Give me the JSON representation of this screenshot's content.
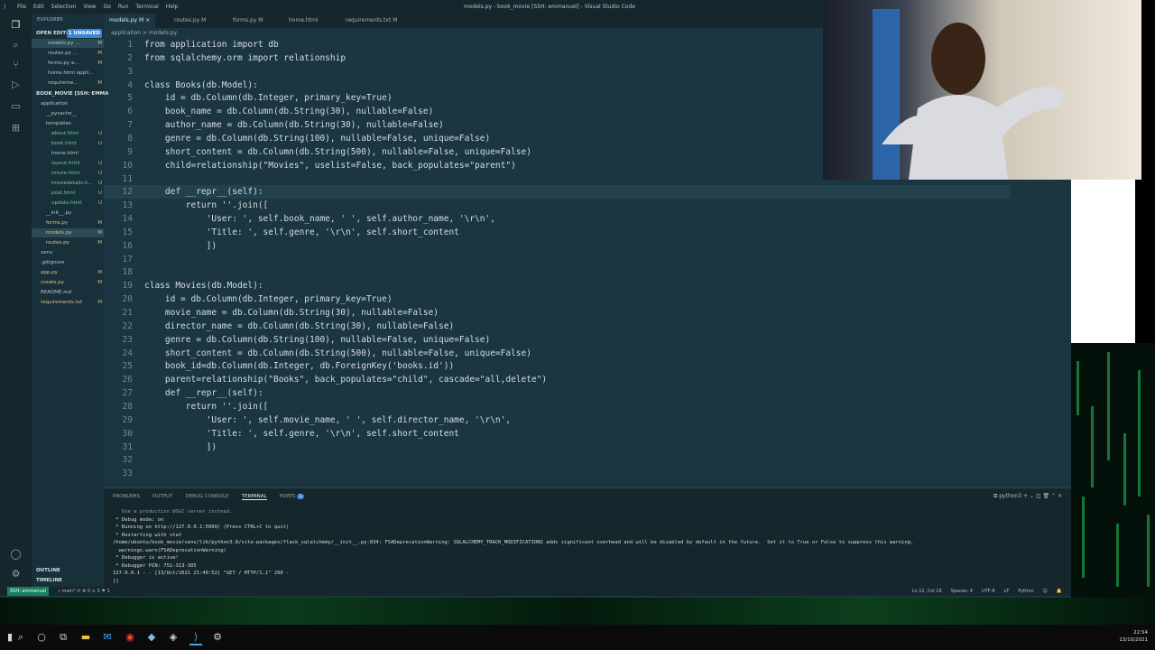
{
  "app": {
    "window_title": "models.py - book_movie [SSH: emmanuel] - Visual Studio Code",
    "menu": [
      "File",
      "Edit",
      "Selection",
      "View",
      "Go",
      "Run",
      "Terminal",
      "Help"
    ]
  },
  "tabs": [
    {
      "label": "models.py M",
      "active": true
    },
    {
      "label": "routes.py M",
      "active": false
    },
    {
      "label": "forms.py M",
      "active": false
    },
    {
      "label": "home.html",
      "active": false
    },
    {
      "label": "requirements.txt M",
      "active": false
    }
  ],
  "breadcrumb": "application > models.py",
  "sidebar": {
    "title": "EXPLORER",
    "open_editors": "OPEN EDITORS",
    "unsaved": "1 UNSAVED",
    "open_files": [
      {
        "name": "models.py ...",
        "badge": "M"
      },
      {
        "name": "routes.py ...",
        "badge": "M"
      },
      {
        "name": "forms.py a...",
        "badge": "M"
      },
      {
        "name": "home.html appli...",
        "badge": ""
      },
      {
        "name": "requireme...",
        "badge": "M"
      }
    ],
    "project": "BOOK_MOVIE [SSH: EMMA...",
    "tree": [
      {
        "name": "application",
        "badge": "",
        "indent": 1
      },
      {
        "name": "__pycache__",
        "badge": "",
        "indent": 2
      },
      {
        "name": "templates",
        "badge": "",
        "indent": 2
      },
      {
        "name": "about.html",
        "badge": "U",
        "indent": 3
      },
      {
        "name": "book.html",
        "badge": "U",
        "indent": 3
      },
      {
        "name": "home.html",
        "badge": "",
        "indent": 3
      },
      {
        "name": "layout.html",
        "badge": "U",
        "indent": 3
      },
      {
        "name": "movie.html",
        "badge": "U",
        "indent": 3
      },
      {
        "name": "moviedetails.h...",
        "badge": "U",
        "indent": 3
      },
      {
        "name": "post.html",
        "badge": "U",
        "indent": 3
      },
      {
        "name": "update.html",
        "badge": "U",
        "indent": 3
      },
      {
        "name": "__init__.py",
        "badge": "",
        "indent": 2
      },
      {
        "name": "forms.py",
        "badge": "M",
        "indent": 2
      },
      {
        "name": "models.py",
        "badge": "M",
        "indent": 2
      },
      {
        "name": "routes.py",
        "badge": "M",
        "indent": 2
      },
      {
        "name": "venv",
        "badge": "",
        "indent": 1
      },
      {
        "name": ".gitignore",
        "badge": "",
        "indent": 1
      },
      {
        "name": "app.py",
        "badge": "M",
        "indent": 1
      },
      {
        "name": "create.py",
        "badge": "M",
        "indent": 1
      },
      {
        "name": "README.md",
        "badge": "",
        "indent": 1
      },
      {
        "name": "requirements.txt",
        "badge": "M",
        "indent": 1
      }
    ],
    "outline": "OUTLINE",
    "timeline": "TIMELINE"
  },
  "code_lines": [
    "from application import db",
    "from sqlalchemy.orm import relationship",
    "",
    "class Books(db.Model):",
    "    id = db.Column(db.Integer, primary_key=True)",
    "    book_name = db.Column(db.String(30), nullable=False)",
    "    author_name = db.Column(db.String(30), nullable=False)",
    "    genre = db.Column(db.String(100), nullable=False, unique=False)",
    "    short_content = db.Column(db.String(500), nullable=False, unique=False)",
    "    child=relationship(\"Movies\", uselist=False, back_populates=\"parent\")",
    "",
    "    def __repr__(self):",
    "        return ''.join([",
    "            'User: ', self.book_name, ' ', self.author_name, '\\r\\n',",
    "            'Title: ', self.genre, '\\r\\n', self.short_content",
    "            ])",
    "",
    "",
    "class Movies(db.Model):",
    "    id = db.Column(db.Integer, primary_key=True)",
    "    movie_name = db.Column(db.String(30), nullable=False)",
    "    director_name = db.Column(db.String(30), nullable=False)",
    "    genre = db.Column(db.String(100), nullable=False, unique=False)",
    "    short_content = db.Column(db.String(500), nullable=False, unique=False)",
    "    book_id=db.Column(db.Integer, db.ForeignKey('books.id'))",
    "    parent=relationship(\"Books\", back_populates=\"child\", cascade=\"all,delete\")",
    "    def __repr__(self):",
    "        return ''.join([",
    "            'User: ', self.movie_name, ' ', self.director_name, '\\r\\n',",
    "            'Title: ', self.genre, '\\r\\n', self.short_content",
    "            ])",
    "",
    ""
  ],
  "panel": {
    "tabs": [
      "PROBLEMS",
      "OUTPUT",
      "DEBUG CONSOLE",
      "TERMINAL",
      "PORTS"
    ],
    "active_tab": "TERMINAL",
    "ports_count": "1",
    "shell": "python3",
    "terminal_lines": [
      "   Use a production WSGI server instead.",
      " * Debug mode: on",
      " * Running on http://127.0.0.1:5000/ (Press CTRL+C to quit)",
      " * Restarting with stat",
      "/home/ubuntu/book_movie/venv/lib/python3.8/site-packages/flask_sqlalchemy/__init__.py:834: FSADeprecationWarning: SQLALCHEMY_TRACK_MODIFICATIONS adds significant overhead and will be disabled by default in the future.  Set it to True or False to suppress this warning.",
      "  warnings.warn(FSADeprecationWarning(",
      " * Debugger is active!",
      " * Debugger PIN: 751-313-305",
      "127.0.0.1 - - [13/Oct/2021 21:49:52] \"GET / HTTP/1.1\" 200 -",
      "[]"
    ]
  },
  "status": {
    "remote": "SSH: emmanuel",
    "branch": "main*",
    "problems": "⊗ 0 ⚠ 0   ⚑ 1",
    "position": "Ln 12, Col 16",
    "spaces": "Spaces: 4",
    "encoding": "UTF-8",
    "eol": "LF",
    "language": "Python"
  },
  "clock": {
    "time": "22:54",
    "date": "13/10/2021"
  },
  "colors": {
    "accent": "#3a88d4",
    "remote": "#16825d",
    "editor_bg": "#1b3640"
  }
}
